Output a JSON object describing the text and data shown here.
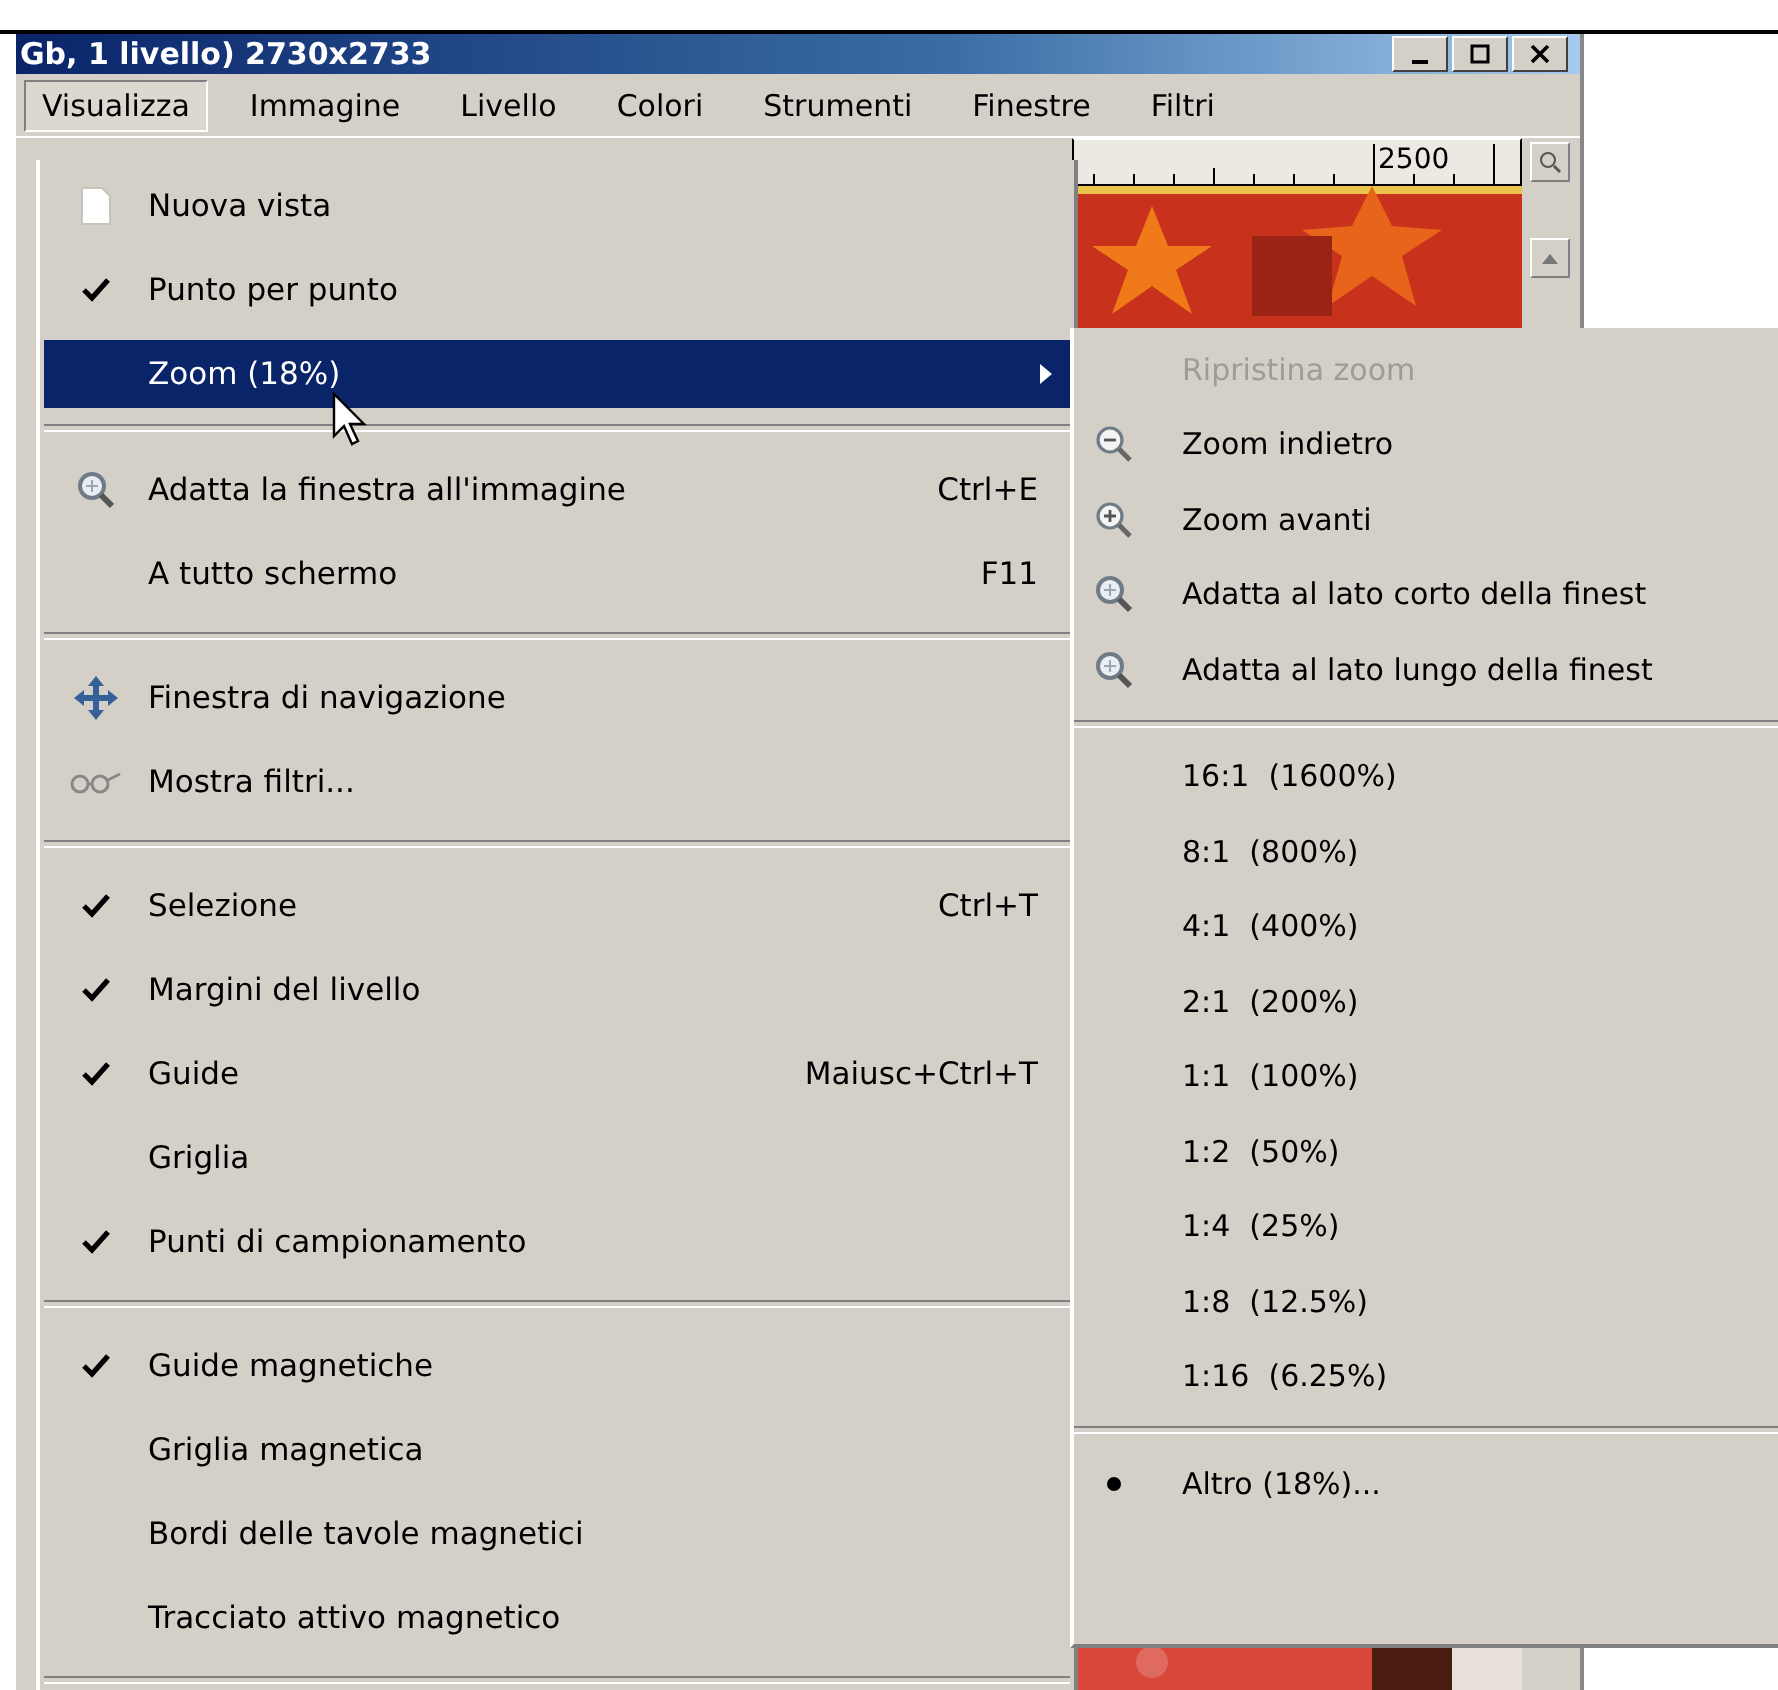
{
  "window": {
    "title": "Gb, 1 livello) 2730x2733"
  },
  "menubar": [
    {
      "label": "Visualizza",
      "selected": true
    },
    {
      "label": "Immagine",
      "selected": false
    },
    {
      "label": "Livello",
      "selected": false
    },
    {
      "label": "Colori",
      "selected": false
    },
    {
      "label": "Strumenti",
      "selected": false
    },
    {
      "label": "Finestre",
      "selected": false
    },
    {
      "label": "Filtri",
      "selected": false
    }
  ],
  "ruler": {
    "label": "2500"
  },
  "menu": {
    "items": [
      {
        "kind": "item",
        "label": "Nuova vista",
        "checked": false,
        "selected": false
      },
      {
        "kind": "item",
        "label": "Punto per punto",
        "checked": true,
        "selected": false
      },
      {
        "kind": "item",
        "label": "Zoom (18%)",
        "checked": false,
        "selected": true,
        "submenu": true
      },
      {
        "kind": "separator"
      },
      {
        "kind": "item",
        "label": "Adatta la finestra all'immagine",
        "shortcut": "Ctrl+E",
        "checked": false,
        "selected": false
      },
      {
        "kind": "item",
        "label": "A tutto schermo",
        "shortcut": "F11",
        "checked": false,
        "selected": false
      },
      {
        "kind": "separator"
      },
      {
        "kind": "item",
        "label": "Finestra di navigazione",
        "checked": false,
        "selected": false
      },
      {
        "kind": "item",
        "label": "Mostra filtri...",
        "checked": false,
        "selected": false
      },
      {
        "kind": "separator"
      },
      {
        "kind": "item",
        "label": "Selezione",
        "shortcut": "Ctrl+T",
        "checked": true,
        "selected": false
      },
      {
        "kind": "item",
        "label": "Margini del livello",
        "checked": true,
        "selected": false
      },
      {
        "kind": "item",
        "label": "Guide",
        "shortcut": "Maiusc+Ctrl+T",
        "checked": true,
        "selected": false
      },
      {
        "kind": "item",
        "label": "Griglia",
        "checked": false,
        "selected": false
      },
      {
        "kind": "item",
        "label": "Punti di campionamento",
        "checked": true,
        "selected": false
      },
      {
        "kind": "separator"
      },
      {
        "kind": "item",
        "label": "Guide magnetiche",
        "checked": true,
        "selected": false
      },
      {
        "kind": "item",
        "label": "Griglia magnetica",
        "checked": false,
        "selected": false
      },
      {
        "kind": "item",
        "label": "Bordi delle tavole magnetici",
        "checked": false,
        "selected": false
      },
      {
        "kind": "item",
        "label": "Tracciato attivo magnetico",
        "checked": false,
        "selected": false
      },
      {
        "kind": "separator"
      }
    ]
  },
  "submenu": {
    "items": [
      {
        "kind": "item",
        "label": "Ripristina zoom",
        "disabled": true
      },
      {
        "kind": "item",
        "label": "Zoom indietro",
        "disabled": false
      },
      {
        "kind": "item",
        "label": "Zoom avanti",
        "disabled": false
      },
      {
        "kind": "item",
        "label": "Adatta al lato corto della finest",
        "disabled": false
      },
      {
        "kind": "item",
        "label": "Adatta al lato lungo della finest",
        "disabled": false
      },
      {
        "kind": "separator"
      },
      {
        "kind": "radio",
        "label": "16:1  (1600%)",
        "selected": false
      },
      {
        "kind": "radio",
        "label": "8:1  (800%)",
        "selected": false
      },
      {
        "kind": "radio",
        "label": "4:1  (400%)",
        "selected": false
      },
      {
        "kind": "radio",
        "label": "2:1  (200%)",
        "selected": false
      },
      {
        "kind": "radio",
        "label": "1:1  (100%)",
        "selected": false
      },
      {
        "kind": "radio",
        "label": "1:2  (50%)",
        "selected": false
      },
      {
        "kind": "radio",
        "label": "1:4  (25%)",
        "selected": false
      },
      {
        "kind": "radio",
        "label": "1:8  (12.5%)",
        "selected": false
      },
      {
        "kind": "radio",
        "label": "1:16  (6.25%)",
        "selected": false
      },
      {
        "kind": "separator"
      },
      {
        "kind": "radio",
        "label": "Altro (18%)...",
        "selected": true
      }
    ]
  }
}
